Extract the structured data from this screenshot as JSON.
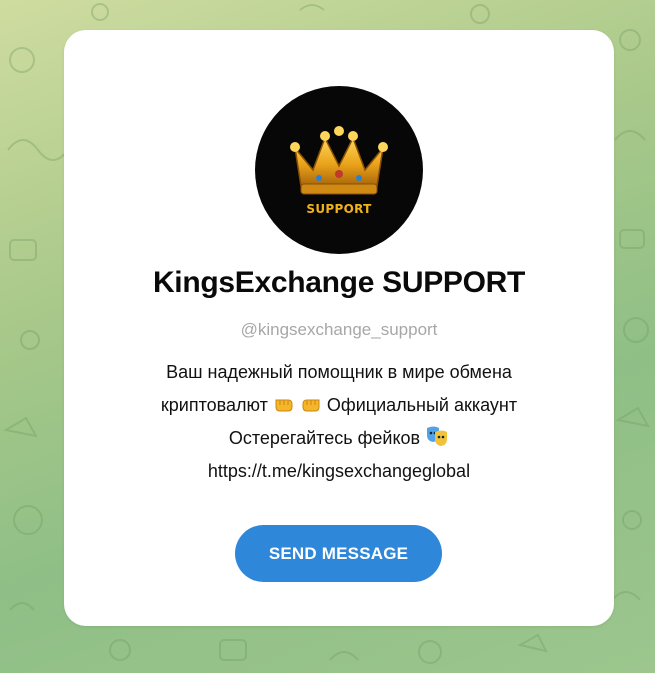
{
  "profile": {
    "avatar_label": "SUPPORT",
    "name": "KingsExchange SUPPORT",
    "username": "@kingsexchange_support",
    "bio": {
      "line1": "Ваш надежный помощник в мире обмена",
      "line2_text_a": "криптовалют",
      "line2_text_b": "Официальный аккаунт",
      "line3_text": "Остерегайтесь фейков",
      "line4_link": "https://t.me/kingsexchangeglobal"
    },
    "emojis": [
      "left-facing-fist-icon",
      "right-facing-fist-icon",
      "performing-arts-icon"
    ]
  },
  "actions": {
    "send_message_label": "SEND MESSAGE"
  },
  "colors": {
    "accent": "#2e87d9",
    "username": "#a7a7a7",
    "avatar_bg": "#070707",
    "crown_gold": "#f0b21a"
  }
}
